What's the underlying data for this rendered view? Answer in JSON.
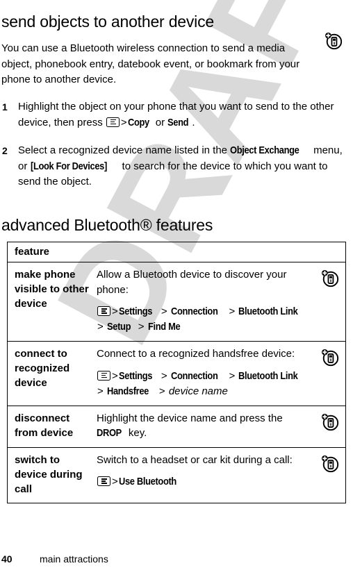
{
  "watermark": {
    "text": "DRAFT"
  },
  "heading_send": "send objects to another device",
  "intro": "You can use a Bluetooth wireless connection to send a media object, phonebook entry, datebook event, or bookmark from your phone to another device.",
  "steps": [
    {
      "number": "1",
      "part1": "Highlight the object on your phone that you want to send to the other device, then press ",
      "menu_icon": "menu-key-icon",
      "gt1": ">",
      "emph1": "Copy",
      "mid": " or ",
      "emph2": "Send",
      "tail": "."
    },
    {
      "number": "2",
      "part1": "Select a recognized device name listed in the ",
      "emph1": "Object Exchange",
      "mid": " menu, or ",
      "emph2": "[Look For Devices]",
      "tail": " to search for the device to which you want to send the object."
    }
  ],
  "heading_advanced": "advanced Bluetooth® features",
  "table": {
    "header": "feature",
    "rows": [
      {
        "feature": "make phone visible to other device",
        "desc": "Allow a Bluetooth device to discover your phone:",
        "path": {
          "has_menu_icon": true,
          "segments": [
            "Settings",
            "Connection",
            "Bluetooth Link",
            "Setup",
            "Find Me"
          ],
          "italic_last": false
        },
        "icon": "bluetooth-device-icon"
      },
      {
        "feature": "connect to recognized device",
        "desc": "Connect to a recognized handsfree device:",
        "path": {
          "has_menu_icon": true,
          "segments": [
            "Settings",
            "Connection",
            "Bluetooth Link",
            "Handsfree",
            "device name"
          ],
          "italic_last": true
        },
        "icon": "bluetooth-device-icon"
      },
      {
        "feature": "disconnect from device",
        "desc_pre": "Highlight the device name and press the ",
        "desc_emph": "DROP",
        "desc_post": " key.",
        "icon": "bluetooth-device-icon"
      },
      {
        "feature": "switch to device during call",
        "desc": "Switch to a headset or car kit during a call:",
        "path": {
          "has_menu_icon": true,
          "segments": [
            "Use Bluetooth"
          ],
          "italic_last": false
        },
        "icon": "bluetooth-device-icon"
      }
    ]
  },
  "footer": {
    "page_number": "40",
    "section": "main attractions"
  }
}
